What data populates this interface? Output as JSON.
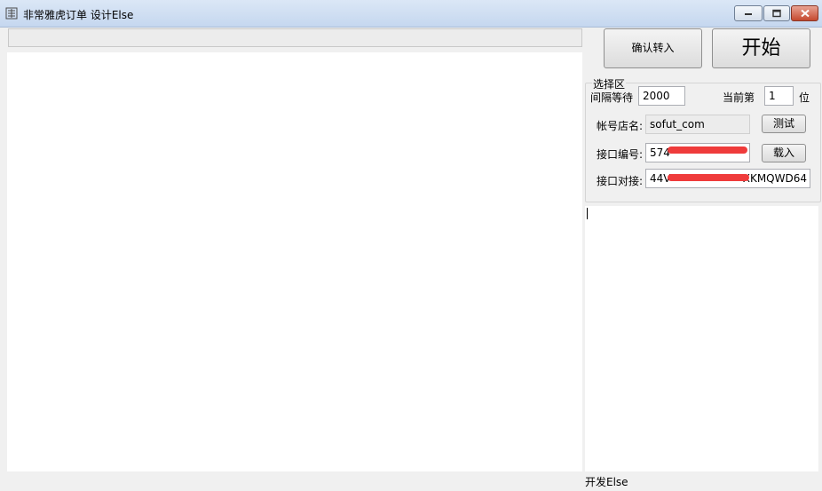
{
  "window": {
    "title": "非常雅虎订单 设计Else",
    "icon": "app-icon",
    "controls": [
      "minimize-icon",
      "maximize-icon",
      "close-icon"
    ]
  },
  "toolbar": {
    "confirm_label": "确认转入",
    "start_label": "开始"
  },
  "select_area": {
    "legend": "选择区",
    "interval_label": "间隔等待",
    "interval_value": "2000",
    "current_label": "当前第",
    "current_value": "1",
    "current_unit": "位",
    "shop_label": "帐号店名:",
    "shop_value": "sofut_com",
    "test_label": "测试",
    "port_id_label": "接口编号:",
    "port_id_value": "574",
    "load_label": "载入",
    "port_conn_label": "接口对接:",
    "port_conn_value": "44V",
    "port_conn_value_end": "XKMQWD64",
    "redaction_color": "#ef3b3b"
  },
  "status": {
    "footer": "开发Else"
  }
}
